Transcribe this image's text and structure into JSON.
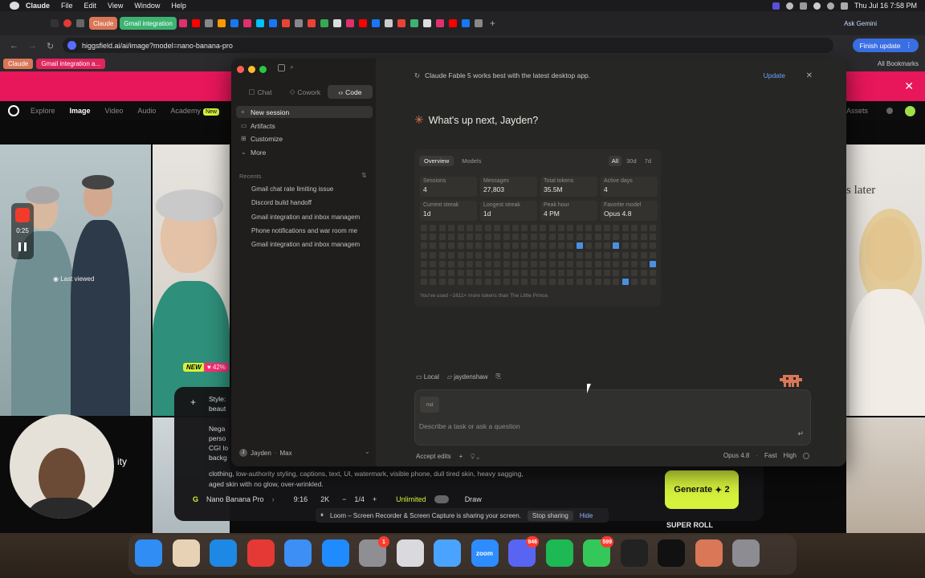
{
  "menubar": {
    "app": "Claude",
    "items": [
      "File",
      "Edit",
      "View",
      "Window",
      "Help"
    ],
    "ask_gemini": "Ask Gemini",
    "datetime": "Thu Jul 16  7:58 PM"
  },
  "browser": {
    "tabs": [
      "Claude",
      "Gmail integration"
    ],
    "url": "higgsfield.ai/ai/image?model=nano-banana-pro",
    "finish_update": "Finish update",
    "bookmarks": [
      "Claude",
      "Gmail integration a..."
    ],
    "all_bookmarks": "All Bookmarks"
  },
  "site": {
    "nav": [
      "Explore",
      "Image",
      "Video",
      "Audio",
      "Academy"
    ],
    "academy_badge": "New",
    "assets": "Assets",
    "recorder_time": "0:25",
    "last_viewed": "Last viewed",
    "new_badge": "NEW",
    "pct_badge": "42%",
    "later_text": "s later",
    "style_label": "Style:",
    "style_value": "beaut",
    "neg_lines": [
      "Nega",
      "perso",
      "CGI lo",
      "backg"
    ],
    "prompt_text": "clothing, low-authority styling, captions, text, UI, watermark, visible phone, dull tired skin, heavy sagging, aged skin with no glow, over-wrinkled.",
    "model": "Nano Banana Pro",
    "ratio": "9:16",
    "quality": "2K",
    "count": "1/4",
    "unlimited": "Unlimited",
    "draw": "Draw",
    "generate": "Generate",
    "generate_cost": "2",
    "webcam_side": "ity",
    "super_roll": "SUPER ROLL"
  },
  "claude": {
    "modes": [
      "Chat",
      "Cowork",
      "Code"
    ],
    "active_mode": "Code",
    "nav": [
      {
        "icon": "+",
        "label": "New session"
      },
      {
        "icon": "▭",
        "label": "Artifacts"
      },
      {
        "icon": "⊞",
        "label": "Customize"
      },
      {
        "icon": "⌄",
        "label": "More"
      }
    ],
    "recents_label": "Recents",
    "recents": [
      "Gmail chat rate limiting issue",
      "Discord build handoff",
      "Gmail integration and inbox managem",
      "Phone notifications and war room me",
      "Gmail integration and inbox managem"
    ],
    "user": {
      "initial": "J",
      "name": "Jayden",
      "plan": "Max"
    },
    "notice": "Claude Fable 5 works best with the latest desktop app.",
    "notice_action": "Update",
    "greeting": "What's up next, Jayden?",
    "stats": {
      "tabs": [
        "Overview",
        "Models"
      ],
      "ranges": [
        "All",
        "30d",
        "7d"
      ],
      "cells": [
        {
          "label": "Sessions",
          "value": "4"
        },
        {
          "label": "Messages",
          "value": "27,803"
        },
        {
          "label": "Total tokens",
          "value": "35.5M"
        },
        {
          "label": "Active days",
          "value": "4"
        },
        {
          "label": "Current streak",
          "value": "1d"
        },
        {
          "label": "Longest streak",
          "value": "1d"
        },
        {
          "label": "Peak hour",
          "value": "4 PM"
        },
        {
          "label": "Favorite model",
          "value": "Opus 4.8"
        }
      ],
      "footnote": "You've used ~1611× more tokens than The Little Prince."
    },
    "context": {
      "env": "Local",
      "folder": "jaydenshaw"
    },
    "composer": {
      "attachment": "md",
      "placeholder": "Describe a task or ask a question"
    },
    "accept_edits": "Accept edits",
    "model": "Opus 4.8",
    "speed": "Fast",
    "effort": "High"
  },
  "loom": {
    "text": "Loom – Screen Recorder & Screen Capture is sharing your screen.",
    "stop": "Stop sharing",
    "hide": "Hide"
  },
  "dock": {
    "apps": [
      {
        "name": "finder",
        "color": "#2f8df3"
      },
      {
        "name": "launchpad",
        "color": "#e7d2b5"
      },
      {
        "name": "safari",
        "color": "#1e88e5"
      },
      {
        "name": "chrome",
        "color": "#e53935"
      },
      {
        "name": "mail",
        "color": "#3d8ef5"
      },
      {
        "name": "app-store",
        "color": "#1f8bff"
      },
      {
        "name": "settings",
        "color": "#8e8e93",
        "badge": "1"
      },
      {
        "name": "iphone-mirroring",
        "color": "#d9d9de"
      },
      {
        "name": "icloud",
        "color": "#4aa3ff"
      },
      {
        "name": "zoom",
        "color": "#2d8cff",
        "label": "zoom"
      },
      {
        "name": "discord",
        "color": "#5865f2",
        "badge": "946"
      },
      {
        "name": "spotify",
        "color": "#1db954"
      },
      {
        "name": "messages",
        "color": "#34c759",
        "badge": "599"
      },
      {
        "name": "terminal",
        "color": "#222222"
      },
      {
        "name": "capcut",
        "color": "#111111"
      },
      {
        "name": "claude",
        "color": "#d97757"
      },
      {
        "name": "trash",
        "color": "#8c8c92"
      }
    ]
  }
}
